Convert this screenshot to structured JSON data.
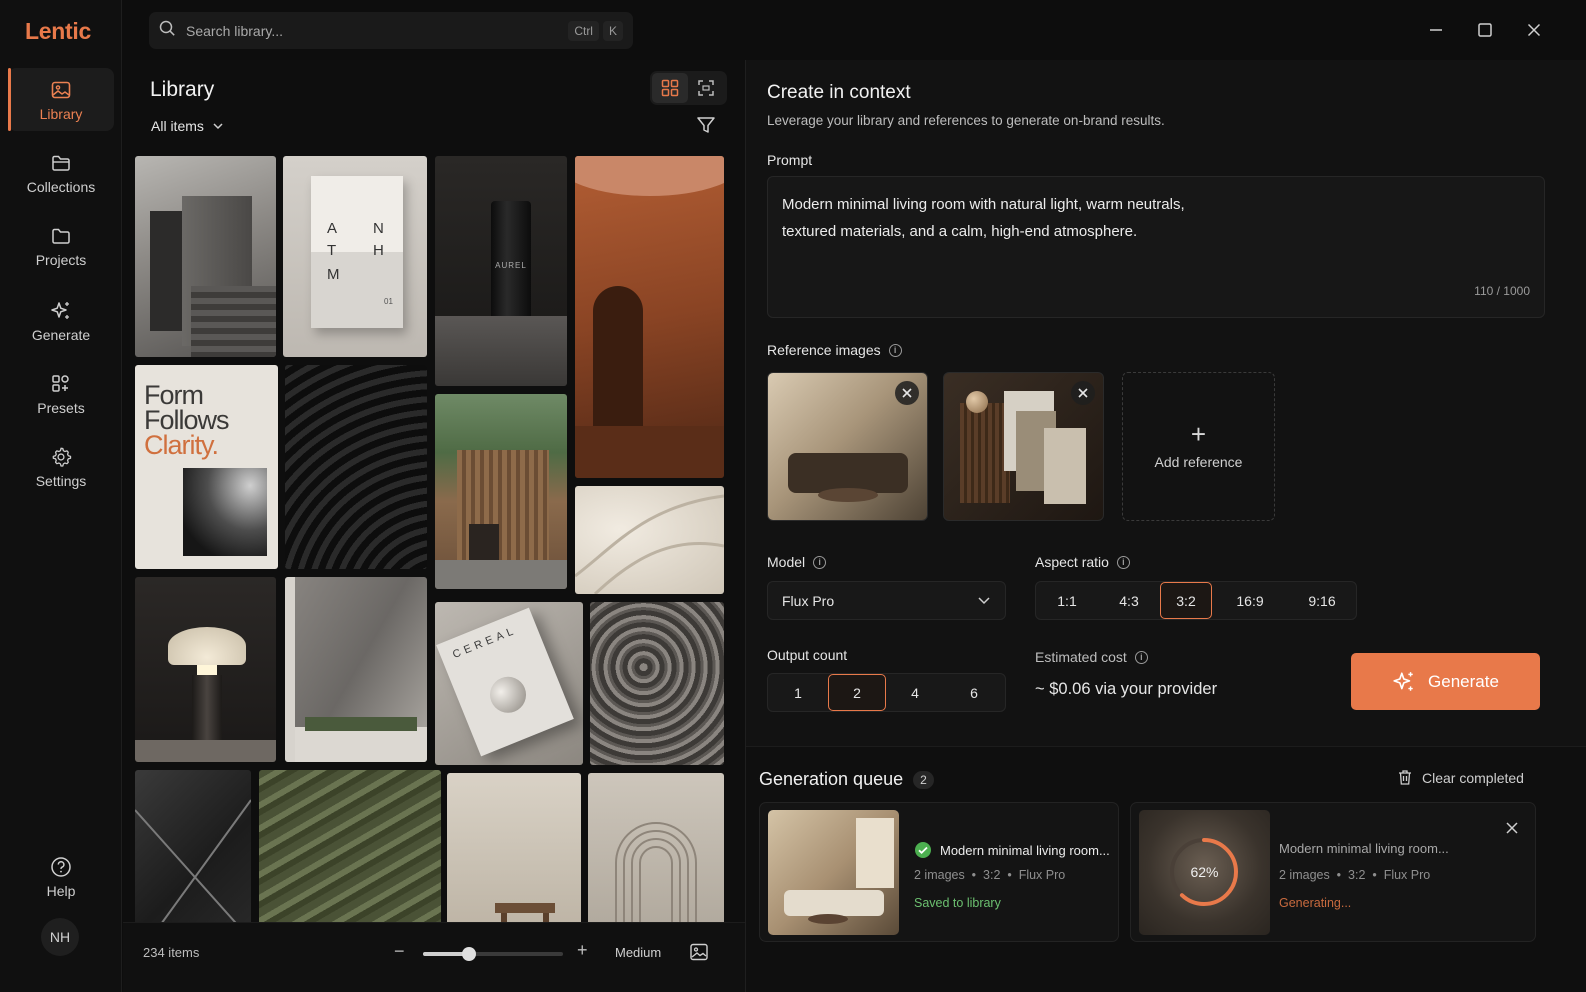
{
  "app": {
    "logo": "Lentic"
  },
  "search": {
    "placeholder": "Search library...",
    "kbd1": "Ctrl",
    "kbd2": "K"
  },
  "sidebar": {
    "items": [
      {
        "label": "Library",
        "icon": "image-icon",
        "active": true
      },
      {
        "label": "Collections",
        "icon": "folder-open-icon"
      },
      {
        "label": "Projects",
        "icon": "folder-icon"
      },
      {
        "label": "Generate",
        "icon": "sparkle-icon"
      },
      {
        "label": "Presets",
        "icon": "presets-icon"
      },
      {
        "label": "Settings",
        "icon": "gear-icon"
      }
    ],
    "help": "Help",
    "avatar": "NH"
  },
  "library": {
    "title": "Library",
    "filter": "All items",
    "count": "234 items",
    "size_label": "Medium",
    "zoom_level": 0.33,
    "tiles": [
      {
        "name": "architecture-doorway"
      },
      {
        "name": "poster-athnm",
        "l1": "A",
        "l2": "N",
        "l3": "T",
        "l4": "H",
        "l5": "M",
        "num": "01"
      },
      {
        "name": "aurel-bottle",
        "brand": "AUREL"
      },
      {
        "name": "terracotta-arch"
      },
      {
        "name": "form-follows-clarity",
        "line1": "Form",
        "line2": "Follows",
        "line3": "Clarity."
      },
      {
        "name": "black-waves"
      },
      {
        "name": "wood-house"
      },
      {
        "name": "plaster-curves"
      },
      {
        "name": "mushroom-lamp"
      },
      {
        "name": "concrete-planter"
      },
      {
        "name": "cereal-magazine",
        "word": "CEREAL"
      },
      {
        "name": "stone-texture"
      },
      {
        "name": "dark-geometry"
      },
      {
        "name": "green-knit"
      },
      {
        "name": "stool-interior"
      },
      {
        "name": "arch-relief"
      }
    ]
  },
  "create": {
    "title": "Create in context",
    "subtitle": "Leverage your library and references to generate on-brand results.",
    "prompt_label": "Prompt",
    "prompt_line1": "Modern minimal living room with natural light, warm neutrals,",
    "prompt_line2": "textured materials, and a calm, high-end atmosphere.",
    "prompt_count": "110 / 1000",
    "ref_label": "Reference images",
    "add_ref": "Add reference",
    "model_label": "Model",
    "model_value": "Flux Pro",
    "aspect_label": "Aspect ratio",
    "aspects": [
      "1:1",
      "4:3",
      "3:2",
      "16:9",
      "9:16"
    ],
    "aspect_selected": "3:2",
    "output_label": "Output count",
    "outputs": [
      "1",
      "2",
      "4",
      "6"
    ],
    "output_selected": "2",
    "cost_label": "Estimated cost",
    "cost_value": "~ $0.06 via your provider",
    "generate": "Generate"
  },
  "queue": {
    "title": "Generation queue",
    "count": "2",
    "clear": "Clear completed",
    "jobs": [
      {
        "name": "Modern minimal living room...",
        "images": "2 images",
        "aspect": "3:2",
        "model": "Flux Pro",
        "status": "Saved to library"
      },
      {
        "name": "Modern minimal living room...",
        "images": "2 images",
        "aspect": "3:2",
        "model": "Flux Pro",
        "status": "Generating...",
        "progress": "62%"
      }
    ]
  },
  "colors": {
    "accent": "#e8794a",
    "success": "#4caf50",
    "bg": "#0d0d0d"
  }
}
